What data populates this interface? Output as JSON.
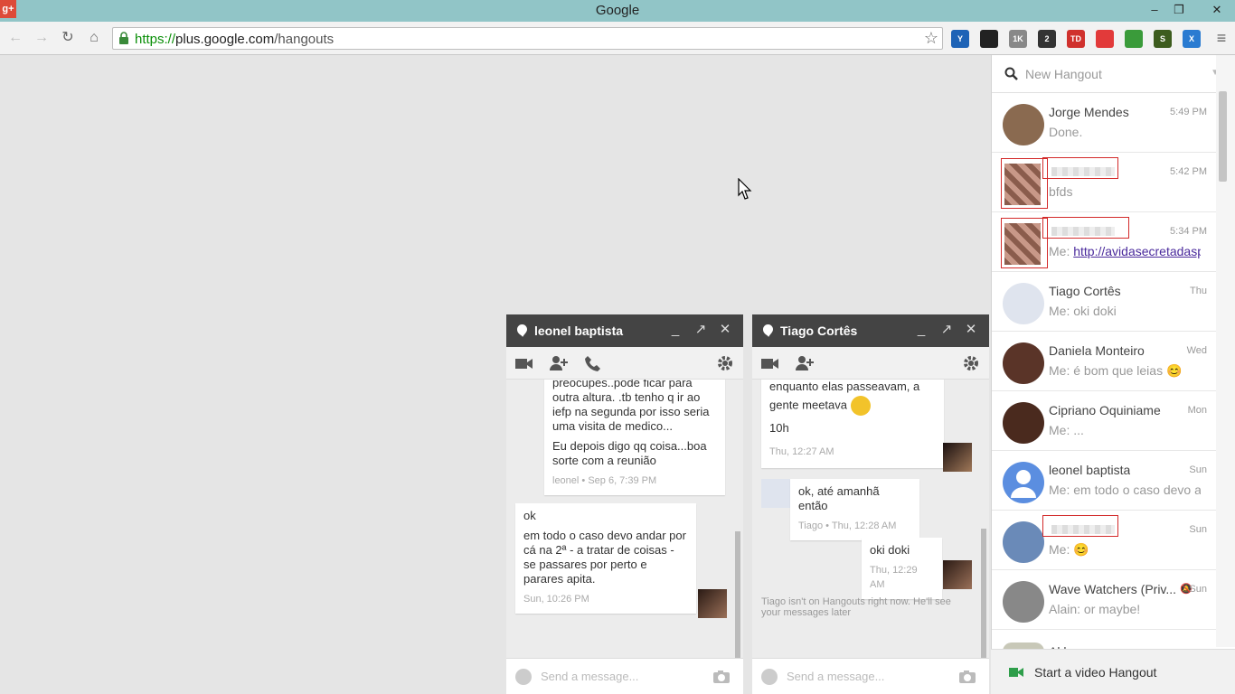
{
  "window": {
    "title": "Google",
    "app_icon": "g+",
    "minimize": "–",
    "restore": "❐",
    "close": "✕"
  },
  "browser": {
    "url_scheme": "https://",
    "url_host": "plus.google.com",
    "url_path": "/hangouts",
    "extensions": [
      {
        "name": "y-icon",
        "label": "Y",
        "color": "#1e63b6"
      },
      {
        "name": "round-icon",
        "label": "",
        "color": "#222222"
      },
      {
        "name": "gplus-count-icon",
        "label": "1K",
        "color": "#888888"
      },
      {
        "name": "list-icon",
        "label": "2",
        "color": "#333333"
      },
      {
        "name": "td-icon",
        "label": "TD",
        "color": "#d0312d"
      },
      {
        "name": "clock-icon",
        "label": "",
        "color": "#e23a3a"
      },
      {
        "name": "green-icon",
        "label": "",
        "color": "#3a9b3a"
      },
      {
        "name": "s-icon",
        "label": "S",
        "color": "#3d5c1e"
      },
      {
        "name": "x-icon",
        "label": "X",
        "color": "#2a7bd1"
      }
    ]
  },
  "chat1": {
    "name": "leonel baptista",
    "messages": [
      {
        "lines": [
          "preocupes..pode ficar para outra altura. .tb tenho q ir ao iefp na segunda por isso seria uma visita de medico...",
          "Eu depois digo qq coisa...boa sorte com a reunião"
        ],
        "meta": "leonel • Sep 6, 7:39 PM"
      },
      {
        "lines": [
          "ok",
          "em todo o caso devo andar por cá na 2ª - a tratar de coisas - se passares por perto e parares apita."
        ],
        "meta": "Sun, 10:26 PM"
      }
    ],
    "input_placeholder": "Send a message..."
  },
  "chat2": {
    "name": "Tiago Cortês",
    "messages": [
      {
        "lines": [
          "enquanto elas passeavam, a gente meetava",
          "10h"
        ],
        "meta": "Thu, 12:27 AM"
      },
      {
        "lines": [
          "ok, até amanhã então"
        ],
        "meta": "Tiago • Thu, 12:28 AM"
      },
      {
        "lines": [
          "oki doki"
        ],
        "meta": "Thu, 12:29 AM"
      }
    ],
    "status": "Tiago isn't on Hangouts right now. He'll see your messages later",
    "input_placeholder": "Send a message..."
  },
  "panel": {
    "search_placeholder": "New Hangout",
    "conversations": [
      {
        "name": "Jorge Mendes",
        "time": "5:49 PM",
        "msg": "Done.",
        "color": "#8a6a50"
      },
      {
        "name": "",
        "time": "5:42 PM",
        "msg": "bfds",
        "color": "#9c6a5a"
      },
      {
        "name": "",
        "time": "5:34 PM",
        "msg_prefix": "Me: ",
        "link": "http://avidasecretadaspla",
        "color": "#8c5c4c"
      },
      {
        "name": "Tiago Cortês",
        "time": "Thu",
        "msg": "Me: oki doki",
        "color": "#dfe4ee"
      },
      {
        "name": "Daniela Monteiro",
        "time": "Wed",
        "msg": "Me: é bom que leias 😊",
        "color": "#5a3428"
      },
      {
        "name": "Cipriano Oquiniame",
        "time": "Mon",
        "msg": "Me: ...",
        "color": "#4a2a1e"
      },
      {
        "name": "leonel baptista",
        "time": "Sun",
        "msg": "Me: em todo o caso devo anc",
        "color": "#5b8ee0"
      },
      {
        "name": "",
        "time": "Sun",
        "msg": "Me: 😊",
        "color": "#6a8ab8"
      },
      {
        "name": "Wave Watchers (Priv...",
        "time": "Sun",
        "msg": "Alain: or maybe!",
        "color": "#888888"
      }
    ],
    "partial_name": "Al.l...",
    "video_label": "Start a video Hangout"
  }
}
